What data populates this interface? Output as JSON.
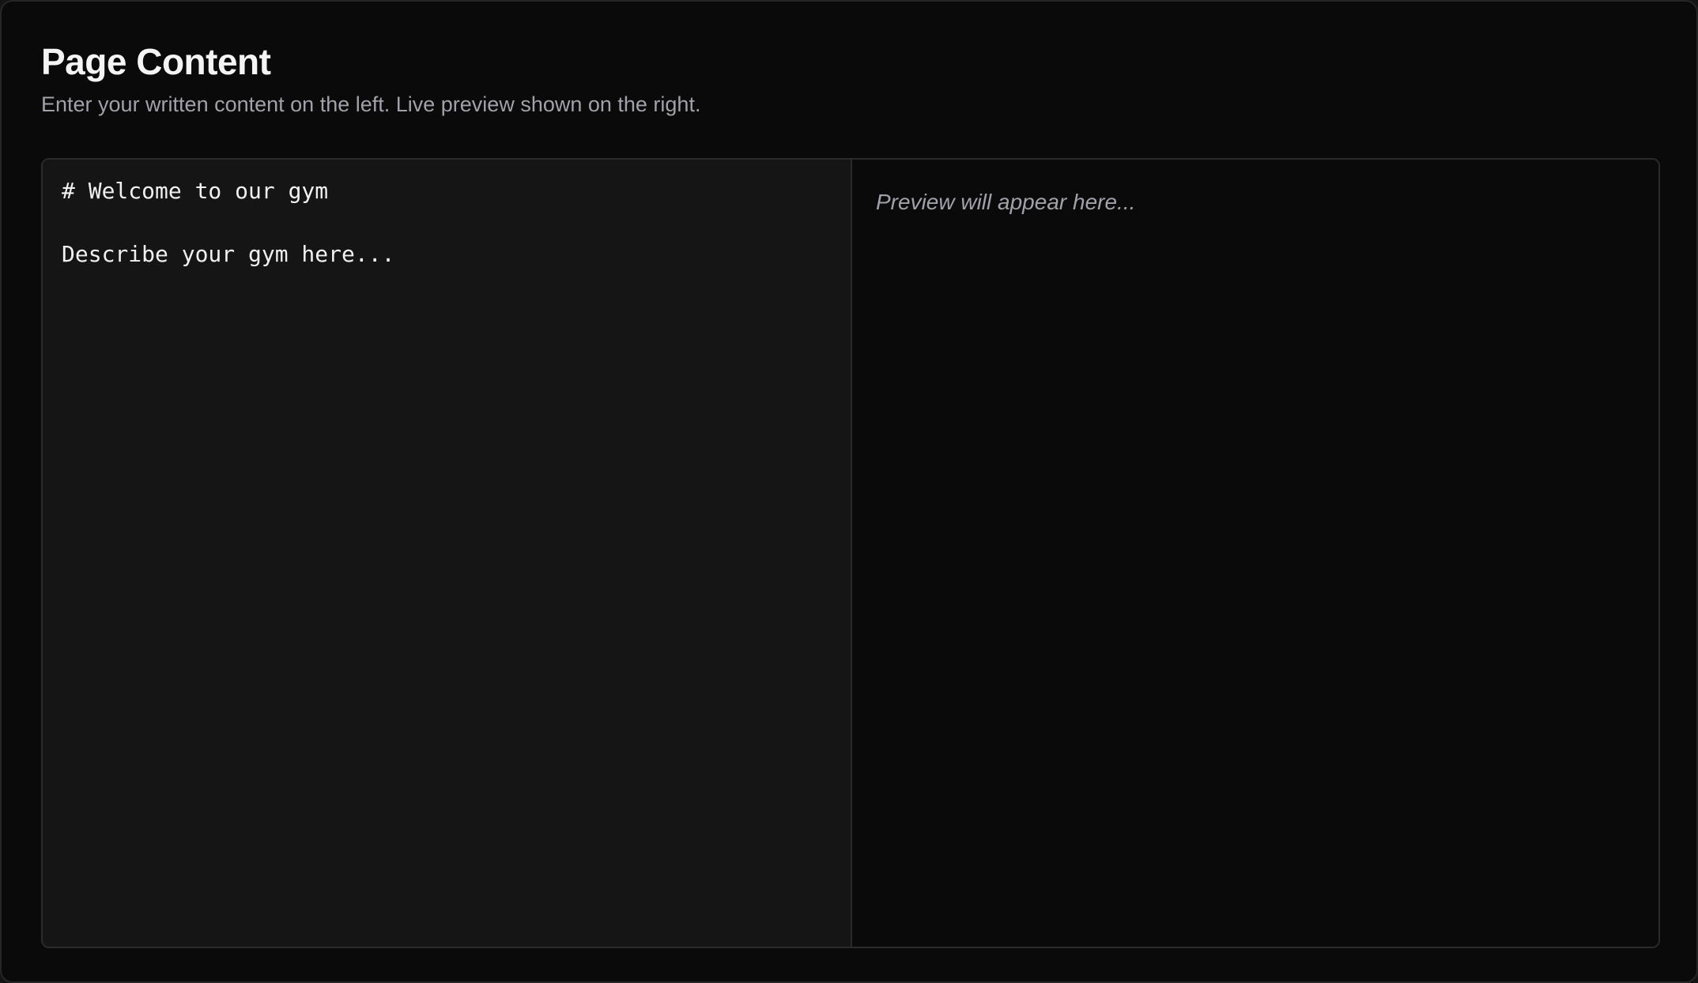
{
  "header": {
    "title": "Page Content",
    "subtitle": "Enter your written content on the left. Live preview shown on the right."
  },
  "editor": {
    "content": "# Welcome to our gym\n\nDescribe your gym here..."
  },
  "preview": {
    "placeholder": "Preview will appear here..."
  },
  "colors": {
    "background": "#0a0a0a",
    "input_pane": "#151515",
    "border": "#2b2b2e",
    "title_text": "#f4f4f5",
    "muted_text": "#a1a1aa"
  }
}
